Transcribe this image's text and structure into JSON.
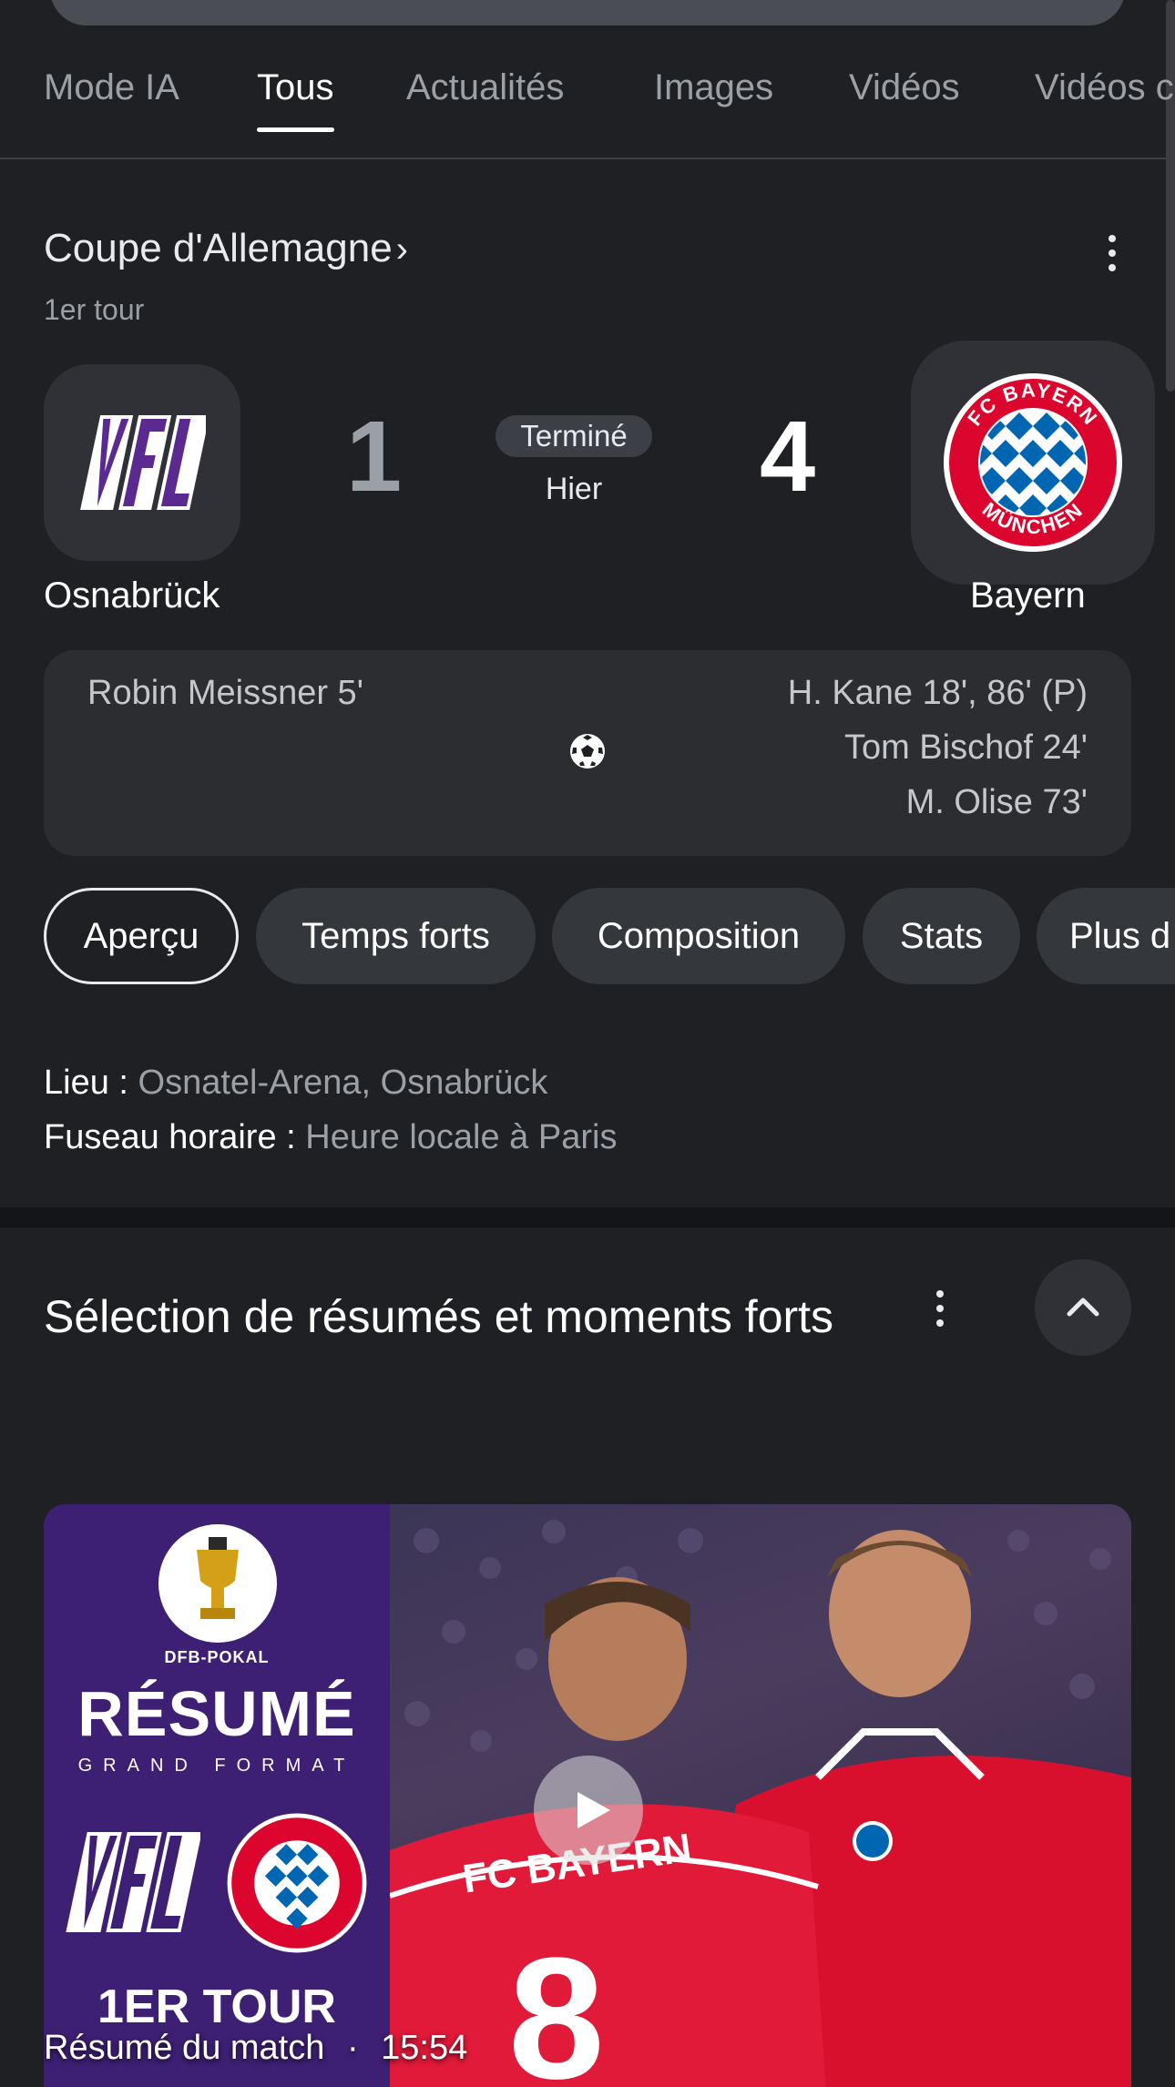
{
  "tabs": [
    {
      "label": "Mode IA"
    },
    {
      "label": "Tous"
    },
    {
      "label": "Actualités"
    },
    {
      "label": "Images"
    },
    {
      "label": "Vidéos"
    },
    {
      "label": "Vidéos c"
    }
  ],
  "match": {
    "competition": "Coupe d'Allemagne",
    "chevron": "›",
    "round": "1er tour",
    "home": {
      "name": "Osnabrück",
      "score": "1",
      "logo_text": "VFL"
    },
    "away": {
      "name": "Bayern",
      "score": "4",
      "logo_text": "FC BAYERN MÜNCHEN"
    },
    "status": "Terminé",
    "date": "Hier",
    "home_scorers": [
      "Robin Meissner 5'"
    ],
    "away_scorers": [
      "H. Kane 18', 86' (P)",
      "Tom Bischof 24'",
      "M. Olise 73'"
    ]
  },
  "chips": [
    {
      "label": "Aperçu"
    },
    {
      "label": "Temps forts"
    },
    {
      "label": "Composition"
    },
    {
      "label": "Stats"
    },
    {
      "label": "Plus d"
    }
  ],
  "info": {
    "venue_label": "Lieu :",
    "venue_value": "Osnatel-Arena, Osnabrück",
    "tz_label": "Fuseau horaire :",
    "tz_value": "Heure locale à Paris"
  },
  "highlights": {
    "title": "Sélection de résumés et moments forts",
    "video": {
      "thumb_top": "DFB-POKAL",
      "thumb_title": "RÉSUMÉ",
      "thumb_subtitle": "GRAND FORMAT",
      "thumb_round": "1ER TOUR",
      "jersey_text": "FC BAYERN",
      "jersey_number": "8",
      "caption": "Résumé du match",
      "separator": "·",
      "duration": "15:54"
    }
  },
  "colors": {
    "background": "#1f2024",
    "card": "#2b2d31",
    "chip": "#34373c",
    "bayern_red": "#dc052d",
    "bayern_blue": "#0066b2",
    "vfl_purple": "#5b2a91"
  }
}
